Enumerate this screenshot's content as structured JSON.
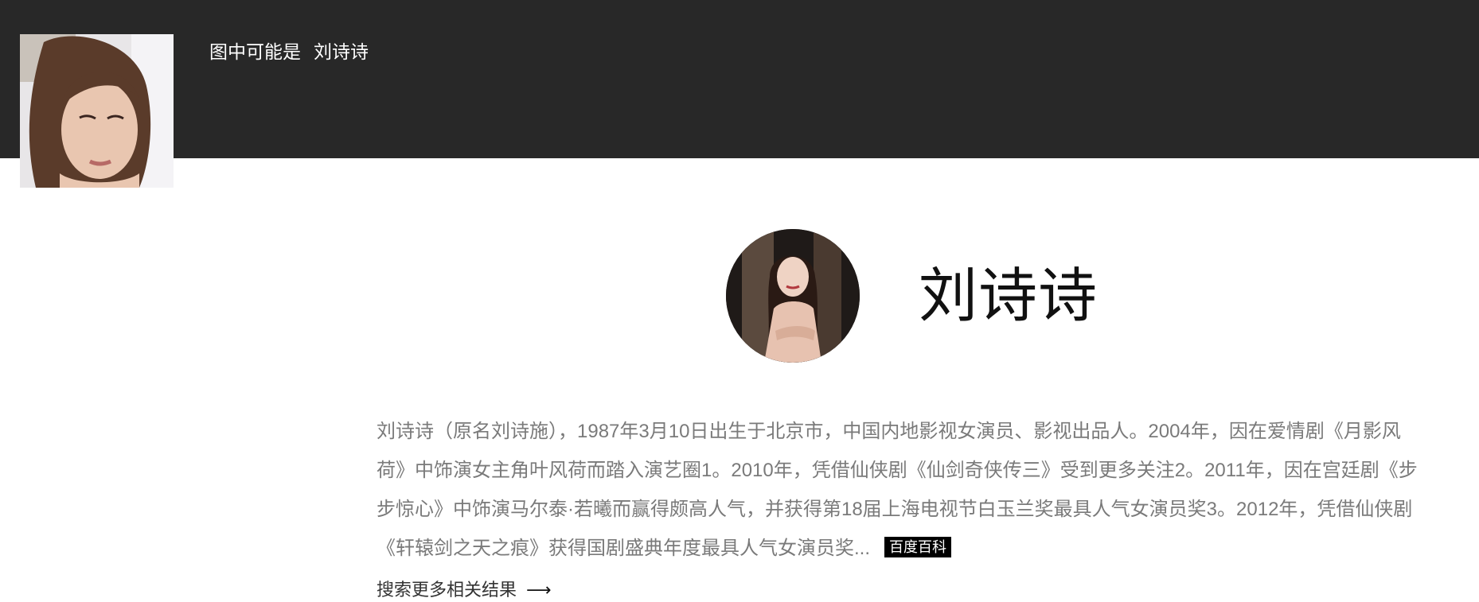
{
  "header": {
    "prefix": "图中可能是",
    "name": "刘诗诗"
  },
  "entity": {
    "title": "刘诗诗",
    "description": "刘诗诗（原名刘诗施），1987年3月10日出生于北京市，中国内地影视女演员、影视出品人。2004年，因在爱情剧《月影风荷》中饰演女主角叶风荷而踏入演艺圈1。2010年，凭借仙侠剧《仙剑奇侠传三》受到更多关注2。2011年，因在宫廷剧《步步惊心》中饰演马尔泰·若曦而赢得颇高人气，并获得第18届上海电视节白玉兰奖最具人气女演员奖3。2012年，凭借仙侠剧《轩辕剑之天之痕》获得国剧盛典年度最具人气女演员奖...",
    "source_label": "百度百科"
  },
  "more_results": {
    "label": "搜索更多相关结果",
    "icon": "arrow-right-icon"
  },
  "colors": {
    "header_bg": "#282828",
    "badge_bg": "#000000",
    "text_gray": "#7a7a7a"
  }
}
